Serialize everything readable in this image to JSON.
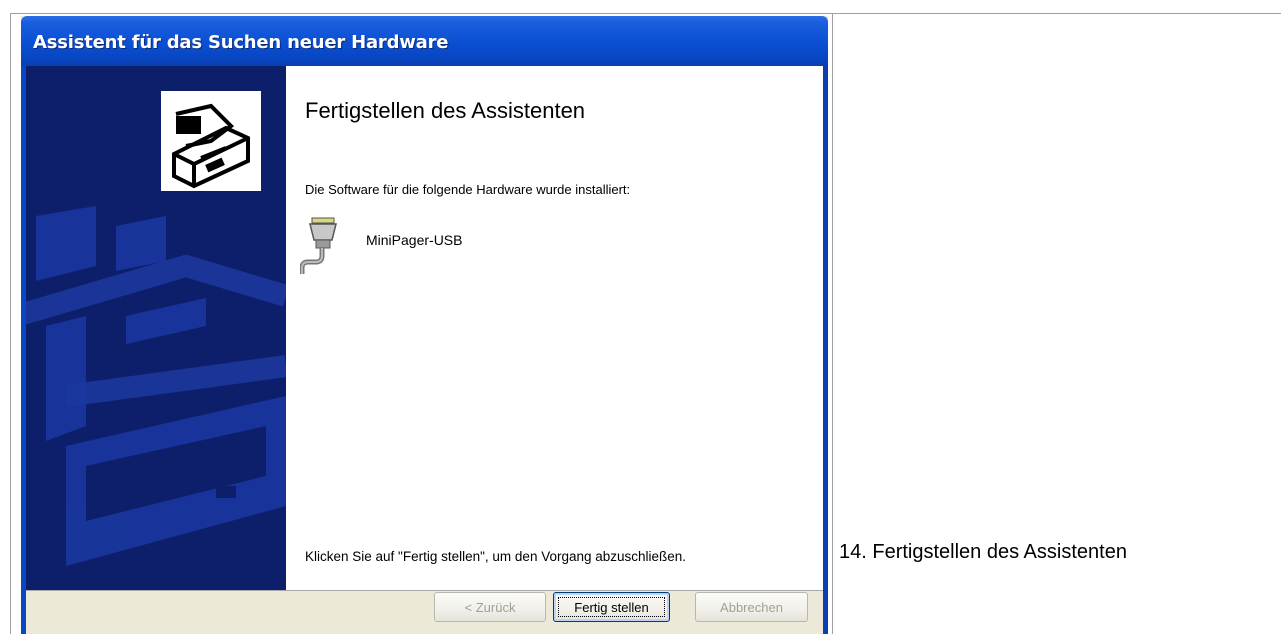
{
  "window": {
    "title": "Assistent für das Suchen neuer Hardware"
  },
  "content": {
    "heading": "Fertigstellen des Assistenten",
    "intro": "Die Software für die folgende Hardware wurde installiert:",
    "device": {
      "icon": "serial-port-icon",
      "name": "MiniPager-USB"
    },
    "finish_note": "Klicken Sie auf \"Fertig stellen\", um den Vorgang abzuschließen."
  },
  "buttons": {
    "back_label": "< Zurück",
    "finish_label": "Fertig stellen",
    "cancel_label": "Abbrechen"
  },
  "caption": "14. Fertigstellen des Assistenten",
  "colors": {
    "titlebar": "#0a4fd2",
    "banner": "#0d1f6a",
    "dialog_face": "#ece9d8"
  }
}
